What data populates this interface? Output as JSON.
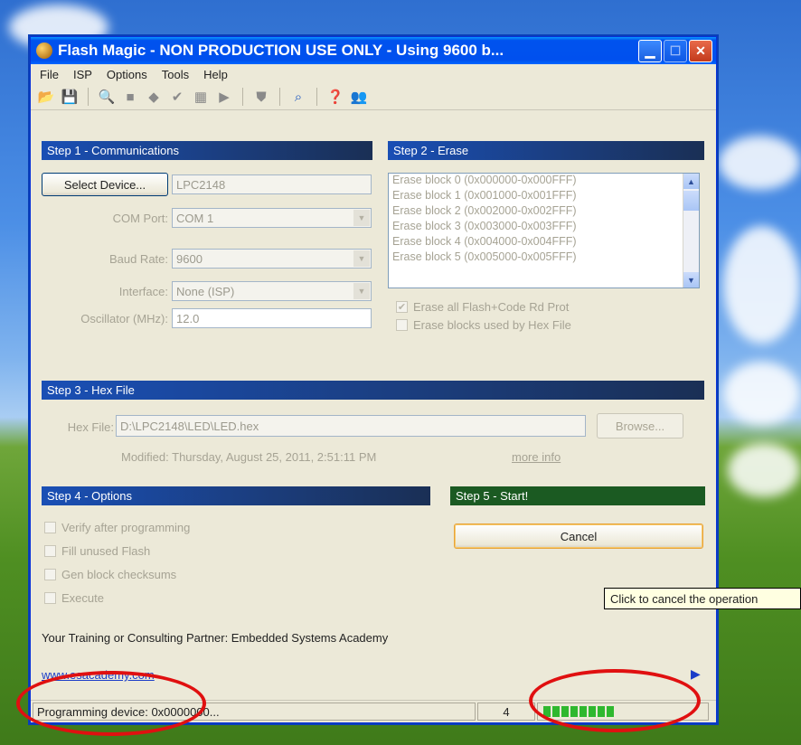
{
  "window": {
    "title": "Flash Magic - NON PRODUCTION USE ONLY - Using 9600 b...",
    "controls": [
      "minimize",
      "maximize",
      "close"
    ]
  },
  "menu": [
    "File",
    "ISP",
    "Options",
    "Tools",
    "Help"
  ],
  "toolbar_icons": [
    "open-icon",
    "save-icon",
    "search-icon",
    "blank-icon",
    "erase-icon",
    "verify-icon",
    "program-icon",
    "go-icon",
    "security-icon",
    "find-icon",
    "help-icon",
    "users-icon"
  ],
  "step1": {
    "header": "Step 1 - Communications",
    "select_device_label": "Select Device...",
    "device_value": "LPC2148",
    "com_port_label": "COM Port:",
    "com_port_value": "COM 1",
    "baud_rate_label": "Baud Rate:",
    "baud_rate_value": "9600",
    "interface_label": "Interface:",
    "interface_value": "None (ISP)",
    "oscillator_label": "Oscillator (MHz):",
    "oscillator_value": "12.0"
  },
  "step2": {
    "header": "Step 2 - Erase",
    "blocks": [
      "Erase block 0 (0x000000-0x000FFF)",
      "Erase block 1 (0x001000-0x001FFF)",
      "Erase block 2 (0x002000-0x002FFF)",
      "Erase block 3 (0x003000-0x003FFF)",
      "Erase block 4 (0x004000-0x004FFF)",
      "Erase block 5 (0x005000-0x005FFF)"
    ],
    "erase_all_label": "Erase all Flash+Code Rd Prot",
    "erase_all_checked": true,
    "erase_used_label": "Erase blocks used by Hex File",
    "erase_used_checked": false
  },
  "step3": {
    "header": "Step 3 - Hex File",
    "hex_file_label": "Hex File:",
    "hex_file_value": "D:\\LPC2148\\LED\\LED.hex",
    "browse_label": "Browse...",
    "modified_text": "Modified: Thursday, August 25, 2011, 2:51:11 PM",
    "more_info_label": "more info"
  },
  "step4": {
    "header": "Step 4 - Options",
    "options": [
      {
        "label": "Verify after programming",
        "checked": false
      },
      {
        "label": "Fill unused Flash",
        "checked": false
      },
      {
        "label": "Gen block checksums",
        "checked": false
      },
      {
        "label": "Execute",
        "checked": false
      }
    ]
  },
  "step5": {
    "header": "Step 5 - Start!",
    "cancel_label": "Cancel"
  },
  "tooltip": "Click to cancel the operation",
  "promo": {
    "text": "Your Training or Consulting Partner: Embedded Systems Academy",
    "link": "www.esacademy.com"
  },
  "status": {
    "message": "Programming device: 0x0000000...",
    "counter": "4",
    "progress_segments": 8
  },
  "colors": {
    "title_blue": "#0053ee",
    "step_header_blue": "#1b3c7a",
    "step_header_green": "#1b5a22",
    "progress_green": "#2fb82f",
    "annotation_red": "#e01010"
  }
}
